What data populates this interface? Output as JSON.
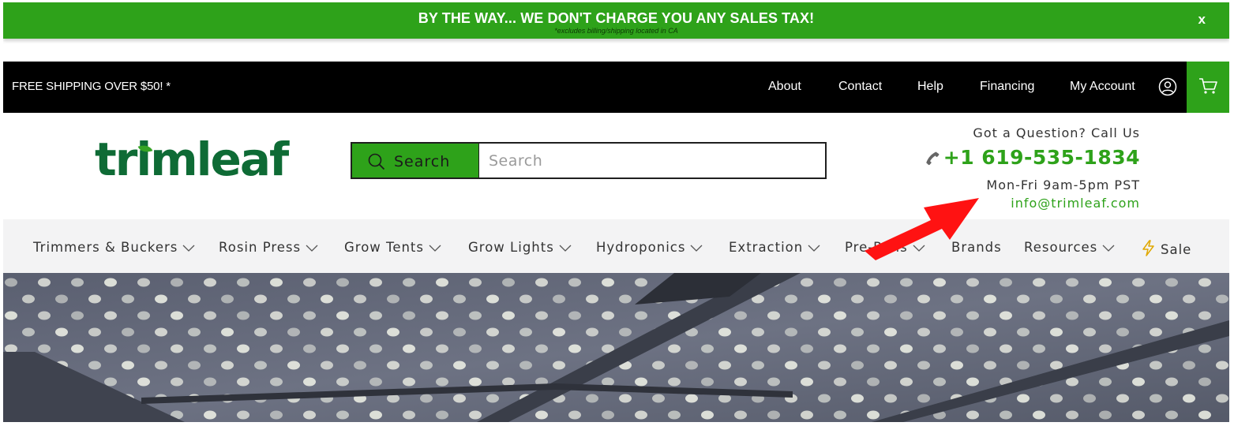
{
  "promo": {
    "title": "BY THE WAY... WE DON'T CHARGE YOU ANY SALES TAX!",
    "subtitle": "*excludes billing/shipping located in CA",
    "close_label": "x",
    "color": "#2ea21a"
  },
  "utility_bar": {
    "shipping_text": "FREE SHIPPING OVER $50! *",
    "links": [
      "About",
      "Contact",
      "Help",
      "Financing",
      "My Account"
    ],
    "account_icon": "user-circle-icon",
    "cart_icon": "cart-icon"
  },
  "header": {
    "logo_text": "trimleaf",
    "search_button_label": "Search",
    "search_placeholder": "Search",
    "contact_question": "Got a Question? Call Us",
    "phone": "+1 619-535-1834",
    "hours": "Mon-Fri 9am-5pm PST",
    "email": "info@trimleaf.com"
  },
  "nav": {
    "items": [
      {
        "label": "Trimmers & Buckers",
        "dropdown": true
      },
      {
        "label": "Rosin Press",
        "dropdown": true
      },
      {
        "label": "Grow Tents",
        "dropdown": true
      },
      {
        "label": "Grow Lights",
        "dropdown": true
      },
      {
        "label": "Hydroponics",
        "dropdown": true
      },
      {
        "label": "Extraction",
        "dropdown": true
      },
      {
        "label": "Pre-Rolls",
        "dropdown": true
      },
      {
        "label": "Brands",
        "dropdown": false
      },
      {
        "label": "Resources",
        "dropdown": true
      },
      {
        "label": "Sale",
        "dropdown": false,
        "icon": "lightning-bolt-icon"
      }
    ]
  },
  "colors": {
    "brand_green": "#2ea21a",
    "logo_green": "#0e6b35",
    "utility_bar": "#000000",
    "nav_background": "#f3f3f4",
    "annotation_arrow": "#ff0000"
  }
}
